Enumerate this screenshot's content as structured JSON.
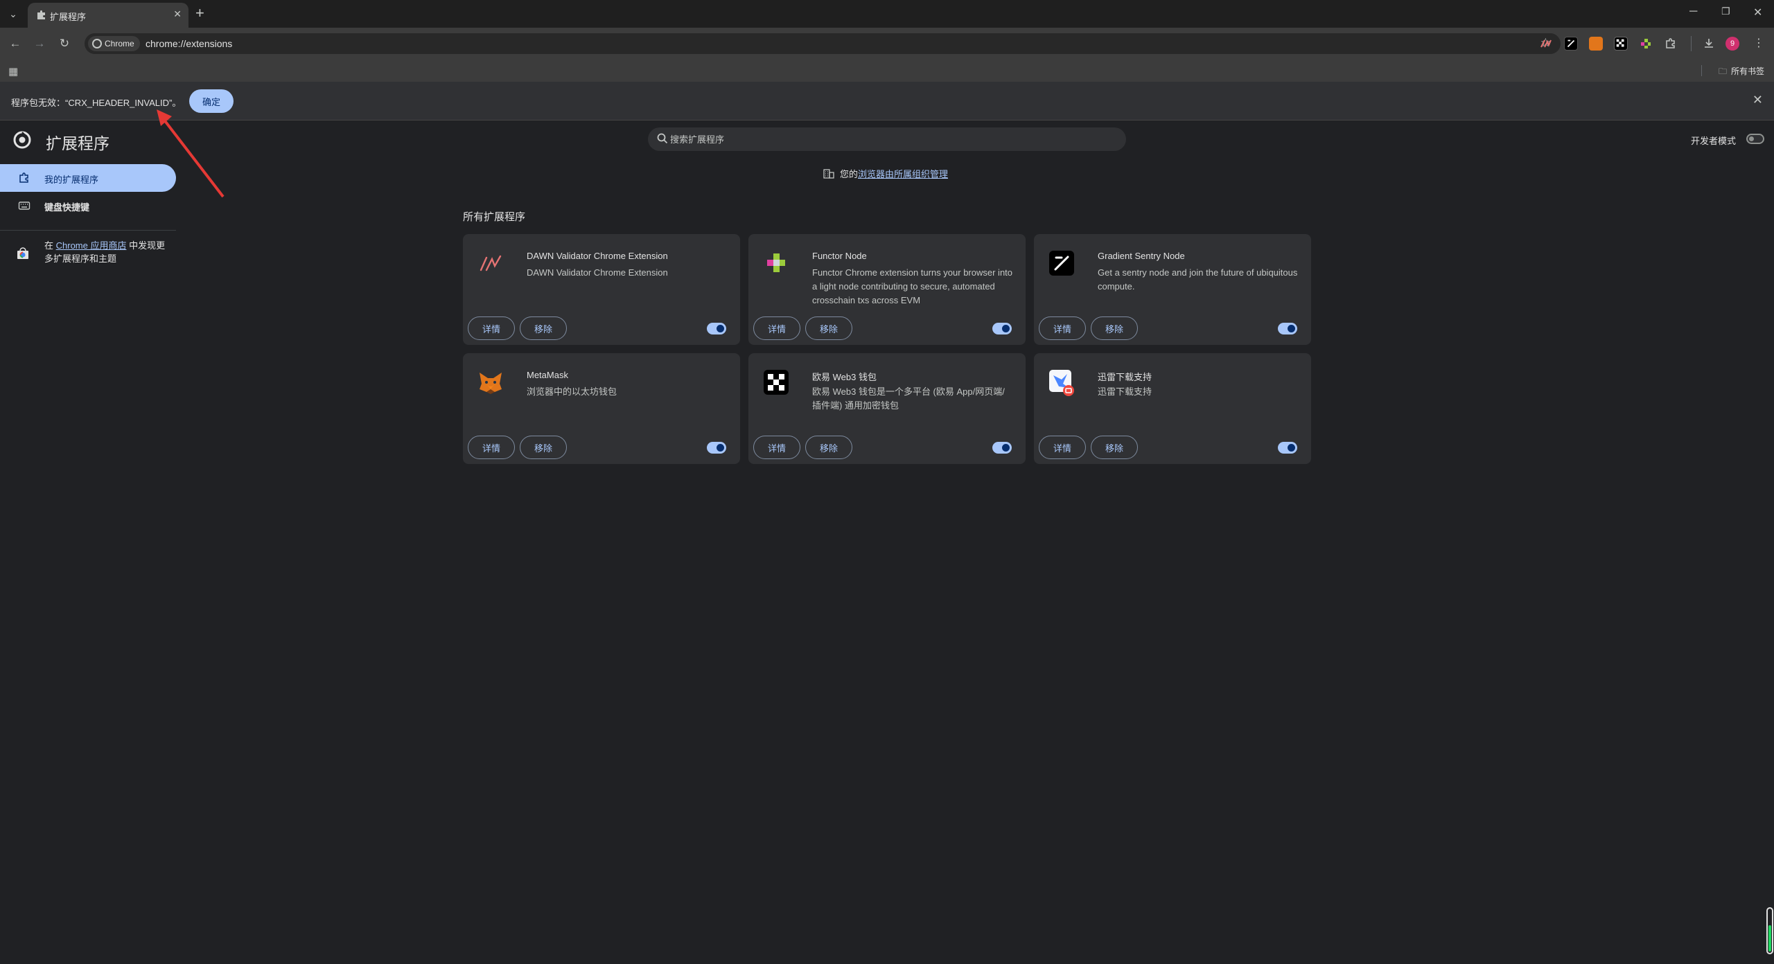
{
  "browser": {
    "tab_title": "扩展程序",
    "chip_label": "Chrome",
    "url": "chrome://extensions",
    "profile_letter": "9",
    "all_bookmarks": "所有书签"
  },
  "infobar": {
    "message": "程序包无效：“CRX_HEADER_INVALID”。",
    "ok_label": "确定"
  },
  "page": {
    "title": "扩展程序",
    "search_placeholder": "搜索扩展程序",
    "dev_mode_label": "开发者模式",
    "managed_prefix": "您的",
    "managed_link": "浏览器由所属组织管理",
    "section_title": "所有扩展程序"
  },
  "sidebar": {
    "items": [
      {
        "label": "我的扩展程序"
      },
      {
        "label": "键盘快捷键"
      }
    ],
    "store_prefix": "在 ",
    "store_link": "Chrome 应用商店",
    "store_suffix": " 中发现更多扩展程序和主题"
  },
  "extensions": [
    {
      "name": "DAWN Validator Chrome Extension",
      "description": "DAWN Validator Chrome Extension",
      "icon": "dawn-icon",
      "enabled": true
    },
    {
      "name": "Functor Node",
      "description": "Functor Chrome extension turns your browser into a light node contributing to secure, automated crosschain txs across EVM",
      "icon": "functor-icon",
      "enabled": true
    },
    {
      "name": "Gradient Sentry Node",
      "description": "Get a sentry node and join the future of ubiquitous compute.",
      "icon": "gradient-icon",
      "enabled": true
    },
    {
      "name": "MetaMask",
      "description": "浏览器中的以太坊钱包",
      "icon": "metamask-fox-icon",
      "enabled": true
    },
    {
      "name": "欧易 Web3 钱包",
      "description": "欧易 Web3 钱包是一个多平台 (欧易 App/网页端/插件端) 通用加密钱包",
      "icon": "okx-icon",
      "enabled": true
    },
    {
      "name": "迅雷下载支持",
      "description": "迅雷下载支持",
      "icon": "thunder-icon",
      "enabled": true
    }
  ],
  "buttons": {
    "details": "详情",
    "remove": "移除"
  },
  "colors": {
    "accent": "#a8c7fa",
    "background": "#202124",
    "card": "#303134",
    "annotation_arrow": "#e53935"
  }
}
